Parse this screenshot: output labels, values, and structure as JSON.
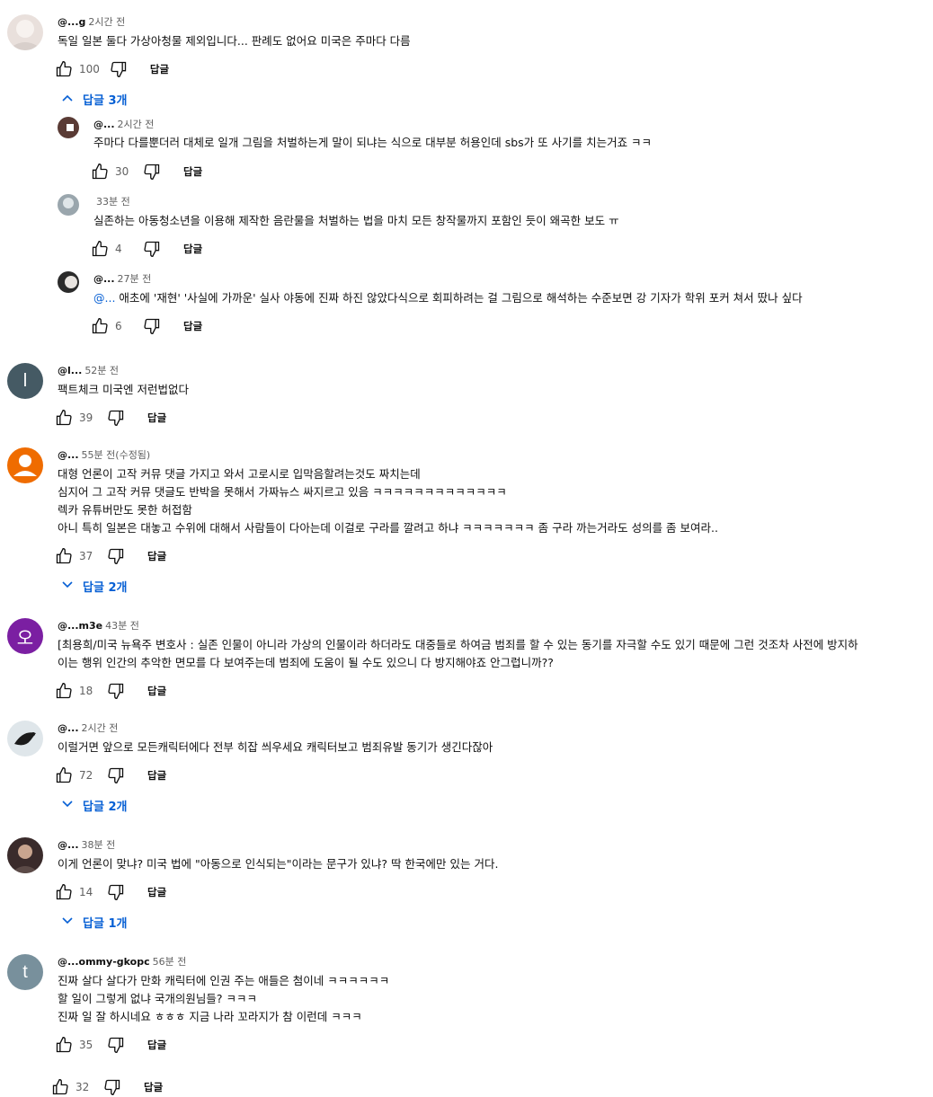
{
  "comments": [
    {
      "handle": "@...g",
      "time": "2시간 전",
      "lines": [
        "독일 일본 둘다 가상아청물 제외입니다... 판례도 없어요 미국은 주마다 다름"
      ],
      "likes": "100",
      "reply_label": "답글",
      "toggle_label": "답글 3개",
      "toggle_dir": "up",
      "avatar_color": "#e9e0dc",
      "replies": [
        {
          "handle": "@...",
          "time": "2시간 전",
          "lines": [
            "주마다 다를뿐더러 대체로 일개 그림을 처벌하는게 말이 되냐는 식으로 대부분 허용인데 sbs가 또 사기를 치는거죠 ㅋㅋ"
          ],
          "likes": "30",
          "reply_label": "답글",
          "avatar_color": "#5a3b35"
        },
        {
          "handle": "",
          "time": "33분 전",
          "lines": [
            "실존하는 아동청소년을 이용해 제작한 음란물을 처벌하는 법을 마치 모든 창작물까지 포함인 듯이 왜곡한 보도 ㅠ"
          ],
          "likes": "4",
          "reply_label": "답글",
          "avatar_color": "#9aa6ad"
        },
        {
          "handle": "@...",
          "time": "27분 전",
          "mention": "@...",
          "lines": [
            "애초에 '재현' '사실에 가까운' 실사 야동에 진짜 하진 않았다식으로  회피하려는 걸 그림으로 해석하는 수준보면 강 기자가 학위 포커 쳐서 땄나 싶다"
          ],
          "likes": "6",
          "reply_label": "답글",
          "avatar_color": "#2b2b2b"
        }
      ]
    },
    {
      "handle": "@l...",
      "time": "52분 전",
      "avatar_letter": "l",
      "avatar_color": "#455a64",
      "lines": [
        "팩트체크 미국엔 저런법없다"
      ],
      "likes": "39",
      "reply_label": "답글"
    },
    {
      "handle": "@...",
      "time": "55분 전(수정됨)",
      "avatar_color": "#ef6c00",
      "lines": [
        "대형 언론이 고작 커뮤 댓글 가지고 와서 고로시로 입막음할려는것도 짜치는데",
        "심지어 그 고작 커뮤 댓글도  반박을 못해서 가짜뉴스 싸지르고 있음 ㅋㅋㅋㅋㅋㅋㅋㅋㅋㅋㅋㅋㅋ",
        "렉카 유튜버만도 못한 허접함",
        "아니 특히 일본은 대놓고 수위에 대해서   사람들이  다아는데 이걸로 구라를 깔려고 하냐 ㅋㅋㅋㅋㅋㅋㅋ 좀 구라 까는거라도   성의를  좀 보여라.."
      ],
      "likes": "37",
      "reply_label": "답글",
      "toggle_label": "답글 2개",
      "toggle_dir": "down"
    },
    {
      "handle": "@...m3e",
      "time": "43분 전",
      "avatar_color": "#7b1fa2",
      "avatar_letter": "오",
      "lines": [
        "[최용희/미국 뉴욕주 변호사 : 실존 인물이 아니라 가상의 인물이라 하더라도 대중들로 하여금 범죄를 할 수 있는 동기를 자극할 수도 있기 때문에 그런 것조차 사전에 방지하",
        "이는 행위 인간의 추악한 면모를 다 보여주는데 범죄에 도움이 될 수도 있으니 다 방지해야죠 안그럽니까??"
      ],
      "likes": "18",
      "reply_label": "답글"
    },
    {
      "handle": "@...",
      "time": "2시간 전",
      "avatar_color": "#dfe6ea",
      "lines": [
        "이럴거면 앞으로 모든캐릭터에다 전부 히잡 씌우세요 캐릭터보고 범죄유발 동기가 생긴다잖아"
      ],
      "likes": "72",
      "reply_label": "답글",
      "toggle_label": "답글 2개",
      "toggle_dir": "down"
    },
    {
      "handle": "@...",
      "time": "38분 전",
      "avatar_color": "#3a2b2b",
      "lines": [
        "이게 언론이 맞냐? 미국 법에 \"아동으로 인식되는\"이라는 문구가 있냐? 딱 한국에만 있는 거다."
      ],
      "likes": "14",
      "reply_label": "답글",
      "toggle_label": "답글 1개",
      "toggle_dir": "down"
    },
    {
      "handle": "@...ommy-gkopc",
      "time": "56분 전",
      "avatar_letter": "t",
      "avatar_color": "#78909c",
      "lines": [
        "진짜 살다 살다가 만화 캐릭터에 인권 주는 애들은 첨이네 ㅋㅋㅋㅋㅋㅋ",
        "할 일이 그렇게 없냐 국개의원님들? ㅋㅋㅋ",
        "진짜 일 잘 하시네요 ㅎㅎㅎ 지금 나라 꼬라지가 참 이런데 ㅋㅋㅋ"
      ],
      "likes": "35",
      "reply_label": "답글"
    },
    {
      "likes": "32",
      "reply_label": "답글"
    }
  ]
}
